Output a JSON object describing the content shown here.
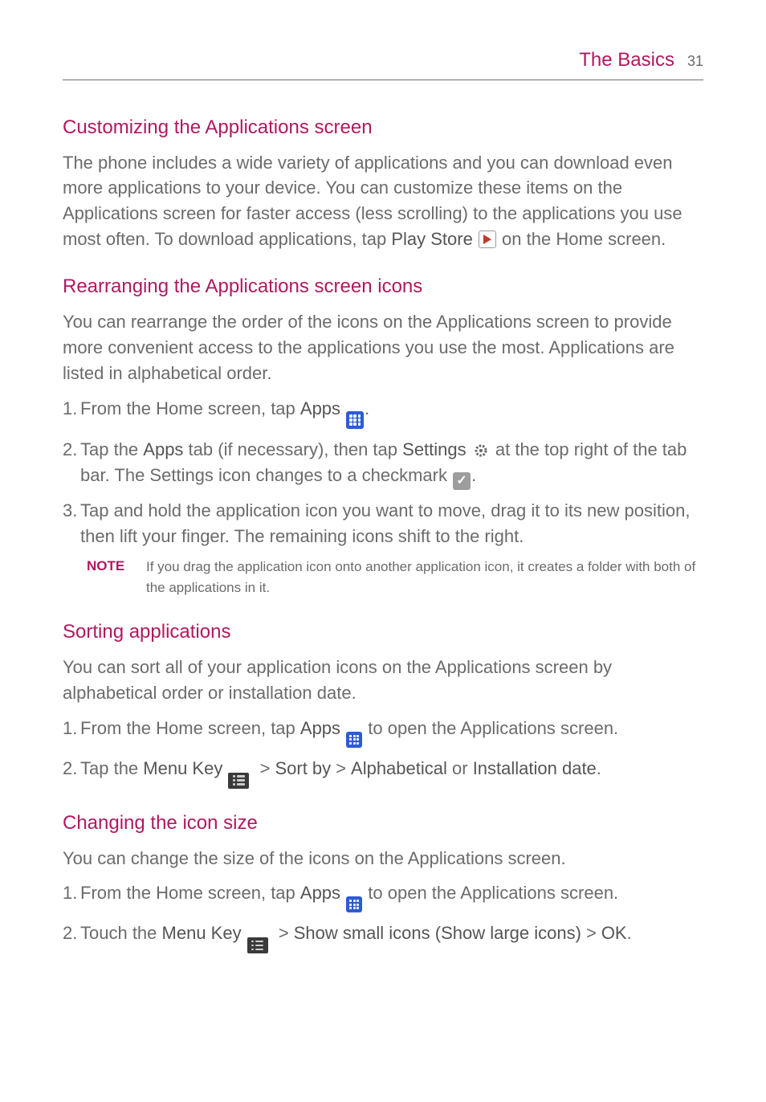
{
  "header": {
    "title": "The Basics",
    "page": "31"
  },
  "s1": {
    "heading": "Customizing the Applications screen",
    "p1a": "The phone includes a wide variety of applications and you can download even more applications to your device. You can customize these items on the Applications screen for faster access (less scrolling) to the applications you use most often. To download applications, tap ",
    "play_store": "Play Store",
    "p1b": " on the Home screen."
  },
  "s2": {
    "heading": "Rearranging the Applications screen icons",
    "p1": "You can rearrange the order of the icons on the Applications screen to provide more convenient access to the applications you use the most. Applications are listed in alphabetical order.",
    "li1a": "From the Home screen, tap ",
    "apps": "Apps",
    "li1b": ".",
    "li2a": "Tap the ",
    "li2b": " tab (if necessary), then tap ",
    "settings": "Settings",
    "li2c": " at the top right of the tab bar. The Settings icon changes to a checkmark ",
    "li2d": ".",
    "li3": "Tap and hold the application icon you want to move, drag it to its new position, then lift your finger. The remaining icons shift to the right.",
    "note_label": "NOTE",
    "note_body": "If you drag the application icon onto another application icon, it creates a folder with both of the applications in it."
  },
  "s3": {
    "heading": "Sorting applications",
    "p1": "You can sort all of your application icons on the Applications screen by alphabetical order or installation date.",
    "li1a": "From the Home screen, tap ",
    "apps": "Apps",
    "li1b": " to open the Applications screen.",
    "li2a": "Tap the ",
    "menu_key": "Menu Key",
    "gt": ">",
    "sort_by": "Sort by",
    "alphabetical": "Alphabetical",
    "or": " or ",
    "install_date": "Installation date",
    "dot": "."
  },
  "s4": {
    "heading": "Changing the icon size",
    "p1": "You can change the size of the icons on the Applications screen.",
    "li1a": "From the Home screen, tap ",
    "apps": "Apps",
    "li1b": " to open the Applications screen.",
    "li2a": "Touch the ",
    "menu_key": "Menu Key",
    "gt": ">",
    "show": "Show small icons (Show large icons)",
    "ok": "OK",
    "dot": "."
  },
  "nums": {
    "n1": "1.",
    "n2": "2.",
    "n3": "3."
  }
}
